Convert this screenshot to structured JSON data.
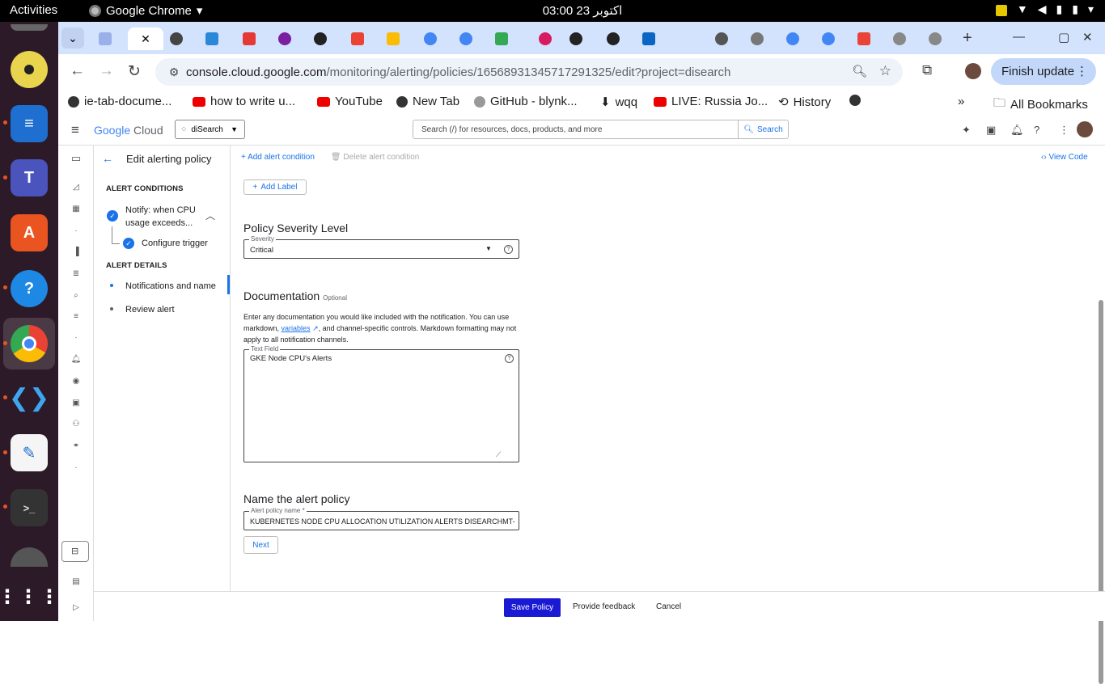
{
  "system": {
    "activities": "Activities",
    "app_name": "Google Chrome",
    "clock": "اکتوبر 23  03:00"
  },
  "browser": {
    "url_host": "console.cloud.google.com",
    "url_path": "/monitoring/alerting/policies/16568931345717291325/edit?project=disearch",
    "finish_update": "Finish update",
    "bookmarks": [
      {
        "label": "ie-tab-docume...",
        "icon": "ie-tab-icon"
      },
      {
        "label": "how to write u...",
        "icon": "youtube-icon"
      },
      {
        "label": "YouTube",
        "icon": "youtube-icon"
      },
      {
        "label": "New Tab",
        "icon": "globe-icon"
      },
      {
        "label": "GitHub - blynk...",
        "icon": "github-icon"
      },
      {
        "label": "wqq",
        "icon": "download-icon"
      },
      {
        "label": "LIVE: Russia Jo...",
        "icon": "youtube-icon"
      },
      {
        "label": "History",
        "icon": "history-icon"
      }
    ],
    "more_bookmarks": "»",
    "all_bookmarks": "All Bookmarks"
  },
  "console": {
    "logo": {
      "google": "Google",
      "cloud": " Cloud"
    },
    "project": "diSearch",
    "search_placeholder": "Search (/) for resources, docs, products, and more",
    "search_button": "Search",
    "page_title": "Edit alerting policy",
    "add_condition": "Add alert condition",
    "delete_condition": "Delete alert condition",
    "view_code": "View Code",
    "nav": {
      "alert_conditions": "ALERT CONDITIONS",
      "condition_line1": "Notify: when CPU",
      "condition_line2": "usage exceeds...",
      "configure_trigger": "Configure trigger",
      "alert_details": "ALERT DETAILS",
      "notifications": "Notifications and name",
      "review": "Review alert"
    },
    "form": {
      "add_label": "Add Label",
      "severity_heading": "Policy Severity Level",
      "severity_label": "Severity",
      "severity_value": "Critical",
      "documentation_heading": "Documentation",
      "documentation_optional": "Optional",
      "doc_desc_1": "Enter any documentation you would like included with the notification. You can use markdown, ",
      "doc_desc_link": "variables",
      "doc_desc_2": ", and channel-specific controls. Markdown formatting may not apply to all notification channels.",
      "text_field_label": "Text Field",
      "text_field_value": "GKE Node CPU's Alerts",
      "name_heading": "Name the alert policy",
      "name_label": "Alert policy name *",
      "name_value": "KUBERNETES NODE CPU ALLOCATION UTILIZATION ALERTS DISEARCHMT-D",
      "next": "Next"
    },
    "footer": {
      "save": "Save Policy",
      "feedback": "Provide feedback",
      "cancel": "Cancel"
    }
  }
}
